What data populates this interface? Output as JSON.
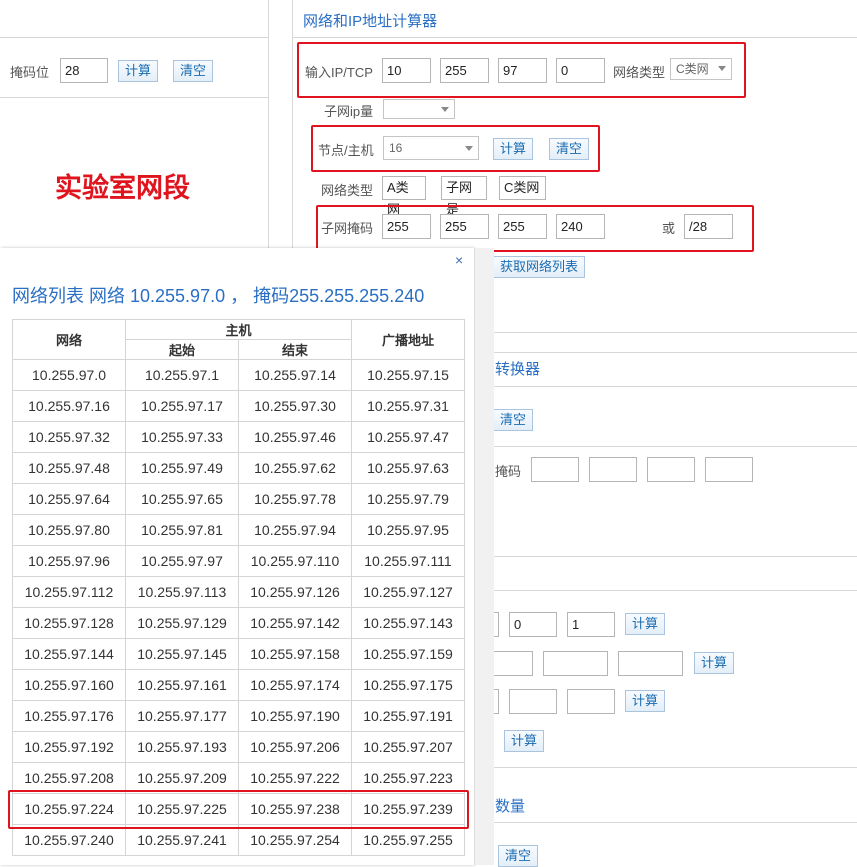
{
  "left_panel": {
    "mask_bits_label": "掩码位",
    "mask_bits_value": "28",
    "calc_label": "计算",
    "clear_label": "清空",
    "annotation": "实验室网段"
  },
  "calculator": {
    "title": "网络和IP地址计算器",
    "input_label": "输入IP/TCP",
    "ip": [
      "10",
      "255",
      "97",
      "0"
    ],
    "net_type_label": "网络类型",
    "net_type_value": "C类网",
    "subnet_ip_label": "子网ip量",
    "hosts_label": "节点/主机",
    "hosts_value": "16",
    "calc_label": "计算",
    "clear_label": "清空",
    "net_type_row_label": "网络类型",
    "net_type_boxes": [
      "A类网",
      "子网是",
      "C类网"
    ],
    "mask_label": "子网掩码",
    "mask": [
      "255",
      "255",
      "255",
      "240"
    ],
    "or_label": "或",
    "prefix": "/28",
    "get_list_label": "获取网络列表"
  },
  "background": {
    "converter_title": "转换器",
    "clear_label": "清空",
    "mask_label": "掩码",
    "row1_values": [
      "0",
      "1"
    ],
    "calc_label": "计算",
    "count_title": "数量"
  },
  "popup": {
    "close": "×",
    "title": "网络列表  网络 10.255.97.0 ，  掩码255.255.255.240",
    "col_network": "网络",
    "col_host": "主机",
    "col_start": "起始",
    "col_end": "结束",
    "col_broadcast": "广播地址",
    "rows": [
      [
        "10.255.97.0",
        "10.255.97.1",
        "10.255.97.14",
        "10.255.97.15"
      ],
      [
        "10.255.97.16",
        "10.255.97.17",
        "10.255.97.30",
        "10.255.97.31"
      ],
      [
        "10.255.97.32",
        "10.255.97.33",
        "10.255.97.46",
        "10.255.97.47"
      ],
      [
        "10.255.97.48",
        "10.255.97.49",
        "10.255.97.62",
        "10.255.97.63"
      ],
      [
        "10.255.97.64",
        "10.255.97.65",
        "10.255.97.78",
        "10.255.97.79"
      ],
      [
        "10.255.97.80",
        "10.255.97.81",
        "10.255.97.94",
        "10.255.97.95"
      ],
      [
        "10.255.97.96",
        "10.255.97.97",
        "10.255.97.110",
        "10.255.97.111"
      ],
      [
        "10.255.97.112",
        "10.255.97.113",
        "10.255.97.126",
        "10.255.97.127"
      ],
      [
        "10.255.97.128",
        "10.255.97.129",
        "10.255.97.142",
        "10.255.97.143"
      ],
      [
        "10.255.97.144",
        "10.255.97.145",
        "10.255.97.158",
        "10.255.97.159"
      ],
      [
        "10.255.97.160",
        "10.255.97.161",
        "10.255.97.174",
        "10.255.97.175"
      ],
      [
        "10.255.97.176",
        "10.255.97.177",
        "10.255.97.190",
        "10.255.97.191"
      ],
      [
        "10.255.97.192",
        "10.255.97.193",
        "10.255.97.206",
        "10.255.97.207"
      ],
      [
        "10.255.97.208",
        "10.255.97.209",
        "10.255.97.222",
        "10.255.97.223"
      ],
      [
        "10.255.97.224",
        "10.255.97.225",
        "10.255.97.238",
        "10.255.97.239"
      ],
      [
        "10.255.97.240",
        "10.255.97.241",
        "10.255.97.254",
        "10.255.97.255"
      ]
    ]
  },
  "colors": {
    "highlight": "#e0141e",
    "link_blue": "#2a6fc4",
    "annotation": "#e0141e"
  }
}
